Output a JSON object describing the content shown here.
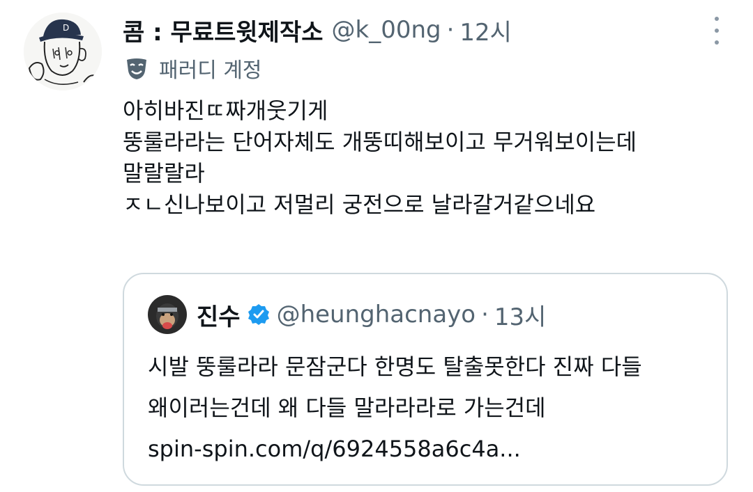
{
  "tweet": {
    "author": {
      "display_name": "콤 : 무료트윗제작소",
      "handle": "@k_00ng",
      "time": "12시",
      "separator": "·",
      "badge_label": "패러디 계정",
      "avatar_icon": "sketch-avatar"
    },
    "more_icon": "more-vertical-icon",
    "body_lines": [
      "아히바진ㄸ짜개웃기게",
      "뚱룰라라는 단어자체도 개뚱띠해보이고 무거워보이는데",
      "말랄랄라",
      "ㅈㄴ신나보이고 저멀리 궁전으로 날라갈거같으네요"
    ],
    "quoted": {
      "display_name": "진수",
      "handle": "@heunghacnayo",
      "separator": "·",
      "time": "13시",
      "verified_color": "#1d9bf0",
      "lines": [
        "시발 뚱룰라라 문잠군다 한명도 탈출못한다 진짜 다들",
        "왜이러는건데 왜 다들 말라라라로 가는건데",
        "spin-spin.com/q/6924558a6c4a..."
      ]
    }
  },
  "colors": {
    "text": "#0f1419",
    "secondary": "#536471",
    "border": "#cfd9de",
    "verified": "#1d9bf0"
  }
}
